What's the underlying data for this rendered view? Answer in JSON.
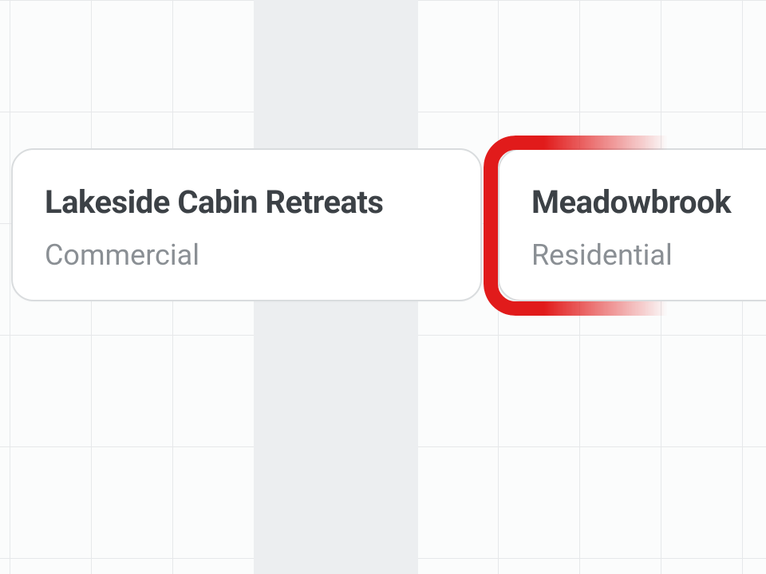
{
  "cards": [
    {
      "title": "Lakeside Cabin Retreats",
      "category": "Commercial"
    },
    {
      "title": "Meadowbrook",
      "category": "Residential"
    }
  ],
  "highlight": {
    "color": "#e11b1b",
    "target_index": 1
  }
}
